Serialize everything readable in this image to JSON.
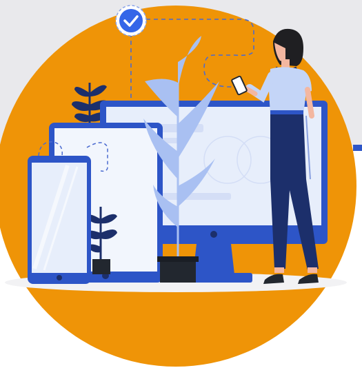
{
  "illustration": {
    "subject": "woman-with-phone-in-front-of-devices",
    "icons": [
      "checkmark-badge-icon",
      "plant-icon",
      "monitor-icon",
      "tablet-icon",
      "phone-icon"
    ]
  },
  "colors": {
    "background": "#ffffff",
    "light_band": "#e9e9ec",
    "circle": "#ef9407",
    "device_blue": "#2d55c7",
    "screen": "#e7eefb",
    "plant_light": "#a9c0f2",
    "navy": "#1c2f6b",
    "dark": "#22272f",
    "shirt": "#c4d5f7",
    "skin": "#f3b7a1",
    "hair": "#1f1f22"
  }
}
